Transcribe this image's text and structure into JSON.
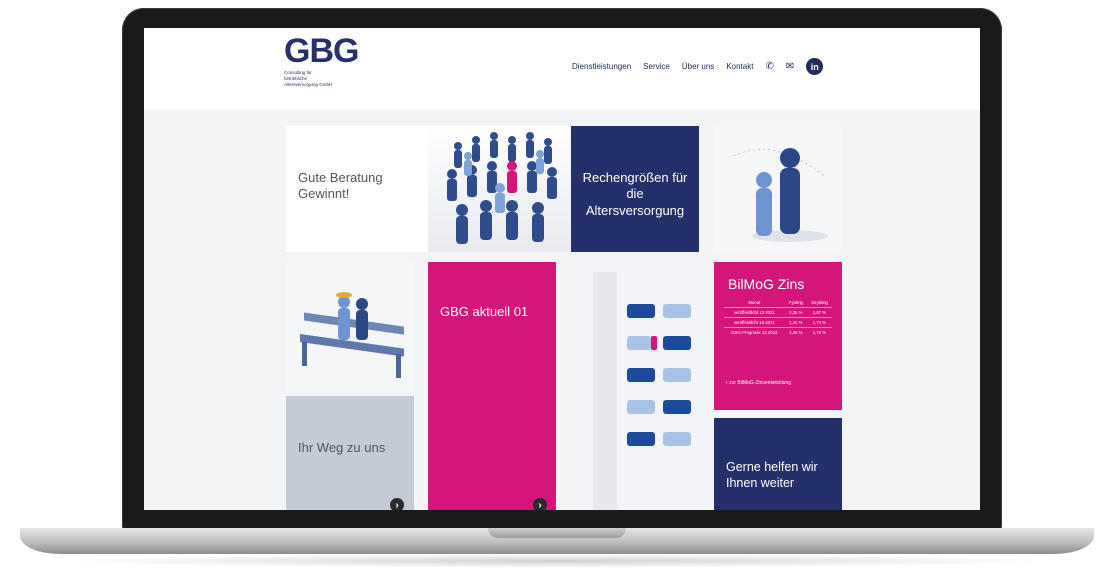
{
  "logo": {
    "letters": "GBG",
    "tagline_lines": [
      "Consulting für",
      "betriebliche",
      "Altersversorgung GmbH"
    ]
  },
  "nav": {
    "items": [
      "Dienstleistungen",
      "Service",
      "Über uns",
      "Kontakt"
    ],
    "linkedin_label": "in"
  },
  "tiles": {
    "beratung": "Gute Beratung Gewinnt!",
    "rechengroessen": "Rechengrößen für die Altersversorgung",
    "aktuell": "GBG aktuell 01",
    "weg": "Ihr Weg zu uns",
    "helfen": "Gerne helfen wir Ihnen weiter"
  },
  "bilmog": {
    "title": "BilMoG Zins",
    "headers": [
      "Monat",
      "7-jährig",
      "15-jährig"
    ],
    "rows": [
      [
        "veröffentlicht 12.2021",
        "1,35 %",
        "1,87 %"
      ],
      [
        "veröffentlicht 10.2021",
        "1,42 %",
        "1,74 %"
      ],
      [
        "GBG-Prognose 12.2022",
        "1,45 %",
        "1,78 %"
      ]
    ],
    "link": "zur BilMoG-Zinsentwicklung"
  },
  "icons": {
    "phone": "phone-icon",
    "mail": "mail-icon",
    "arrow": "chevron-right-icon"
  },
  "colors": {
    "navy": "#25306a",
    "pink": "#d4157a",
    "grey": "#c4cad6"
  }
}
